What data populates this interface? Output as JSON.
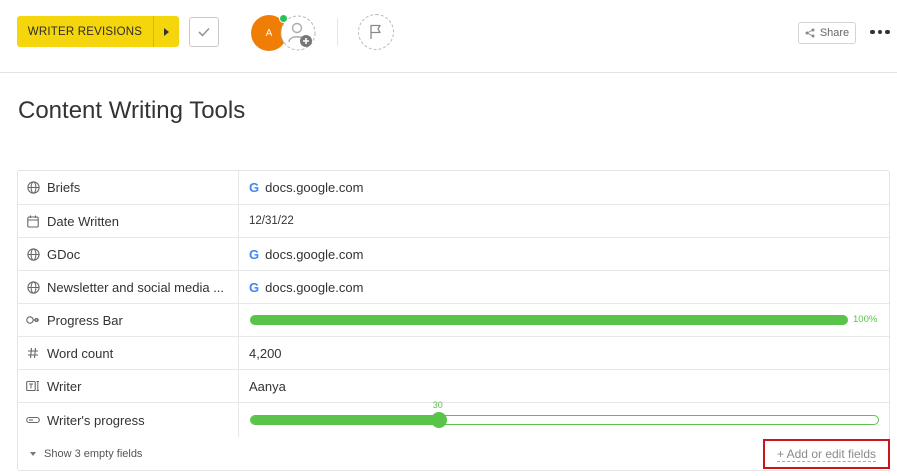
{
  "header": {
    "status_label": "WRITER REVISIONS",
    "avatar_initial": "A",
    "share_label": "Share"
  },
  "page": {
    "title": "Content Writing Tools"
  },
  "fields": [
    {
      "label": "Briefs",
      "icon": "globe-icon",
      "type": "link",
      "value": "docs.google.com"
    },
    {
      "label": "Date Written",
      "icon": "calendar-icon",
      "type": "date",
      "value": "12/31/22"
    },
    {
      "label": "GDoc",
      "icon": "globe-icon",
      "type": "link",
      "value": "docs.google.com"
    },
    {
      "label": "Newsletter and social media ...",
      "icon": "globe-icon",
      "type": "link",
      "value": "docs.google.com"
    },
    {
      "label": "Progress Bar",
      "icon": "progress-icon",
      "type": "progress",
      "value": "100%",
      "percent": 100
    },
    {
      "label": "Word count",
      "icon": "hash-icon",
      "type": "number",
      "value": "4,200"
    },
    {
      "label": "Writer",
      "icon": "text-field-icon",
      "type": "text",
      "value": "Aanya"
    },
    {
      "label": "Writer's progress",
      "icon": "slider-icon",
      "type": "slider",
      "value": "30",
      "percent": 30
    }
  ],
  "footer": {
    "show_empty_label": "Show 3 empty fields",
    "add_fields_label": "+ Add or edit fields"
  },
  "colors": {
    "status": "#f5d60c",
    "avatar": "#f07e06",
    "online": "#25c45a",
    "progress": "#5ac34a",
    "highlight_border": "#c8161d"
  }
}
